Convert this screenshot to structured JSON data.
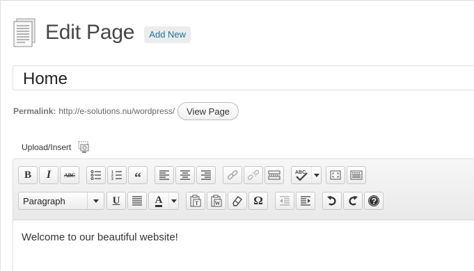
{
  "header": {
    "title": "Edit Page",
    "add_new_label": "Add New"
  },
  "title_field": {
    "value": "Home"
  },
  "permalink": {
    "label": "Permalink:",
    "url": "http://e-solutions.nu/wordpress/",
    "view_label": "View Page"
  },
  "upload": {
    "label": "Upload/Insert"
  },
  "toolbar": {
    "row1": [
      "bold-icon",
      "italic-icon",
      "strikethrough-icon",
      "bullet-list-icon",
      "numbered-list-icon",
      "blockquote-icon",
      "align-left-icon",
      "align-center-icon",
      "align-right-icon",
      "link-icon",
      "unlink-icon",
      "more-tag-icon",
      "spellcheck-icon",
      "fullscreen-icon",
      "kitchen-sink-icon"
    ],
    "row2": [
      "format-select",
      "underline-icon",
      "justify-icon",
      "text-color-icon",
      "paste-text-icon",
      "paste-word-icon",
      "clear-formatting-icon",
      "special-character-icon",
      "outdent-icon",
      "indent-icon",
      "undo-icon",
      "redo-icon",
      "help-icon"
    ],
    "format_value": "Paragraph",
    "bold_glyph": "B",
    "italic_glyph": "I",
    "strike_glyph": "ABC",
    "underline_glyph": "U",
    "text_color_glyph": "A",
    "omega_glyph": "Ω",
    "quote_glyph": "“",
    "spell_glyph": "ABC"
  },
  "editor": {
    "content": "Welcome to our beautiful website!"
  },
  "colors": {
    "link_blue": "#21759b",
    "title_gray": "#464646",
    "toolbar_bg": "#f0f0f0"
  }
}
